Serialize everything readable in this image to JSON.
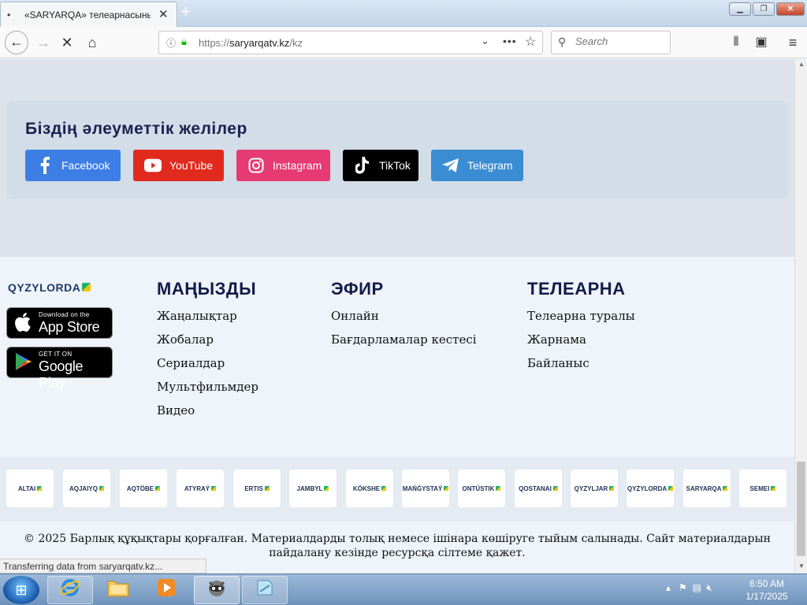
{
  "browser": {
    "tab_title": "«SARYARQA» телеарнасының",
    "tab_dot": "•",
    "url_prefix": "https://",
    "url_domain": "saryarqatv.kz",
    "url_path": "/kz",
    "search_placeholder": "Search",
    "status_text": "Transferring data from saryarqatv.kz..."
  },
  "social": {
    "title": "Біздің әлеуметтік желілер",
    "buttons": [
      {
        "label": "Facebook",
        "color": "#3d7ee4",
        "icon": "facebook-icon"
      },
      {
        "label": "YouTube",
        "color": "#e02a1e",
        "icon": "youtube-icon"
      },
      {
        "label": "Instagram",
        "color": "#e63b72",
        "icon": "instagram-icon"
      },
      {
        "label": "TikTok",
        "color": "#000000",
        "icon": "tiktok-icon"
      },
      {
        "label": "Telegram",
        "color": "#3a8dd2",
        "icon": "telegram-icon"
      }
    ]
  },
  "footer": {
    "logo": "QYZYLORDA",
    "appstore": {
      "small": "Download on the",
      "big": "App Store"
    },
    "googleplay": {
      "small": "GET IT ON",
      "big": "Google Play"
    },
    "columns": [
      {
        "title": "МАҢЫЗДЫ",
        "links": [
          "Жаңалықтар",
          "Жобалар",
          "Сериалдар",
          "Мультфильмдер",
          "Видео"
        ]
      },
      {
        "title": "ЭФИР",
        "links": [
          "Онлайн",
          "Бағдарламалар кестесі"
        ]
      },
      {
        "title": "ТЕЛЕАРНА",
        "links": [
          "Телеарна туралы",
          "Жарнама",
          "Байланыс"
        ]
      }
    ],
    "channels": [
      "ALTAI",
      "AQJAIYQ",
      "AQTÖBE",
      "ATYRAÝ",
      "ERTIS",
      "JAMBYL",
      "KÓKSHE",
      "MAŃǴYSTAÝ",
      "ONTÚSTIK",
      "QOSTANAI",
      "QYZYLJAR",
      "QYZYLORDA",
      "SARYARQA",
      "SEMEI"
    ],
    "copyright_line1": "© 2025 Барлық құқықтары қорғалған. Материалдарды толық немесе ішінара көшіруге тыйым салынады. Сайт материалдарын",
    "copyright_line2": "пайдалану кезінде ресурсқа сілтеме қажет."
  },
  "taskbar": {
    "time": "6:50 AM",
    "date": "1/17/2025"
  }
}
